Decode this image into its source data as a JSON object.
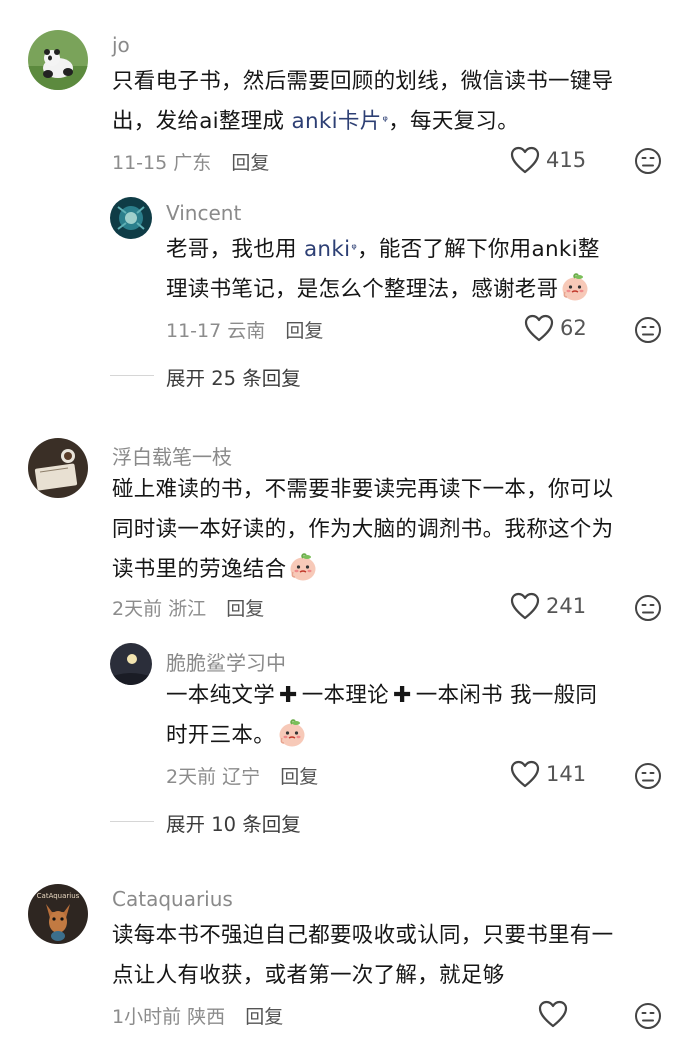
{
  "comments": [
    {
      "username": "jo",
      "lines": [
        {
          "text": "只看电子书，然后需要回顾的划线，微信读书一键导"
        },
        {
          "pre": "出，发给ai整理成 ",
          "keyword": "anki卡片",
          "post": "，每天复习。"
        }
      ],
      "date": "11-15",
      "location": "广东",
      "reply_label": "回复",
      "likes": "415"
    },
    {
      "username": "Vincent",
      "lines": [
        {
          "pre": "老哥，我也用 ",
          "keyword": "anki",
          "post": "，能否了解下你用anki整"
        },
        {
          "text": "理读书笔记，是怎么个整理法，感谢老哥"
        }
      ],
      "date": "11-17",
      "location": "云南",
      "reply_label": "回复",
      "likes": "62",
      "expand": "展开 25 条回复"
    },
    {
      "username": "浮白载笔一枝",
      "lines": [
        {
          "text": "碰上难读的书，不需要非要读完再读下一本，你可以"
        },
        {
          "text": "同时读一本好读的，作为大脑的调剂书。我称这个为"
        },
        {
          "text": "读书里的劳逸结合"
        }
      ],
      "date": "2天前",
      "location": "浙江",
      "reply_label": "回复",
      "likes": "241"
    },
    {
      "username": "脆脆鲨学习中",
      "lines": [
        {
          "a": "一本纯文学",
          "b": "一本理论",
          "c": "一本闲书 我一般同"
        },
        {
          "text": "时开三本。"
        }
      ],
      "date": "2天前",
      "location": "辽宁",
      "reply_label": "回复",
      "likes": "141",
      "expand": "展开 10 条回复"
    },
    {
      "username": "Cataquarius",
      "avatar_text": "CatAquarius",
      "lines": [
        {
          "text": "读每本书不强迫自己都要吸收或认同，只要书里有一"
        },
        {
          "text": "点让人有收获，或者第一次了解，就足够"
        }
      ],
      "date": "1小时前",
      "location": "陕西",
      "reply_label": "回复",
      "likes": ""
    }
  ],
  "icons": {
    "like": "heart-outline-icon",
    "dislike": "unhappy-face-icon",
    "emoji": "peach-emoji",
    "keyword_search": "search-icon"
  },
  "colors": {
    "username": "#8a8a8a",
    "keyword": "#2d3f74",
    "meta": "#8c8c8c"
  }
}
